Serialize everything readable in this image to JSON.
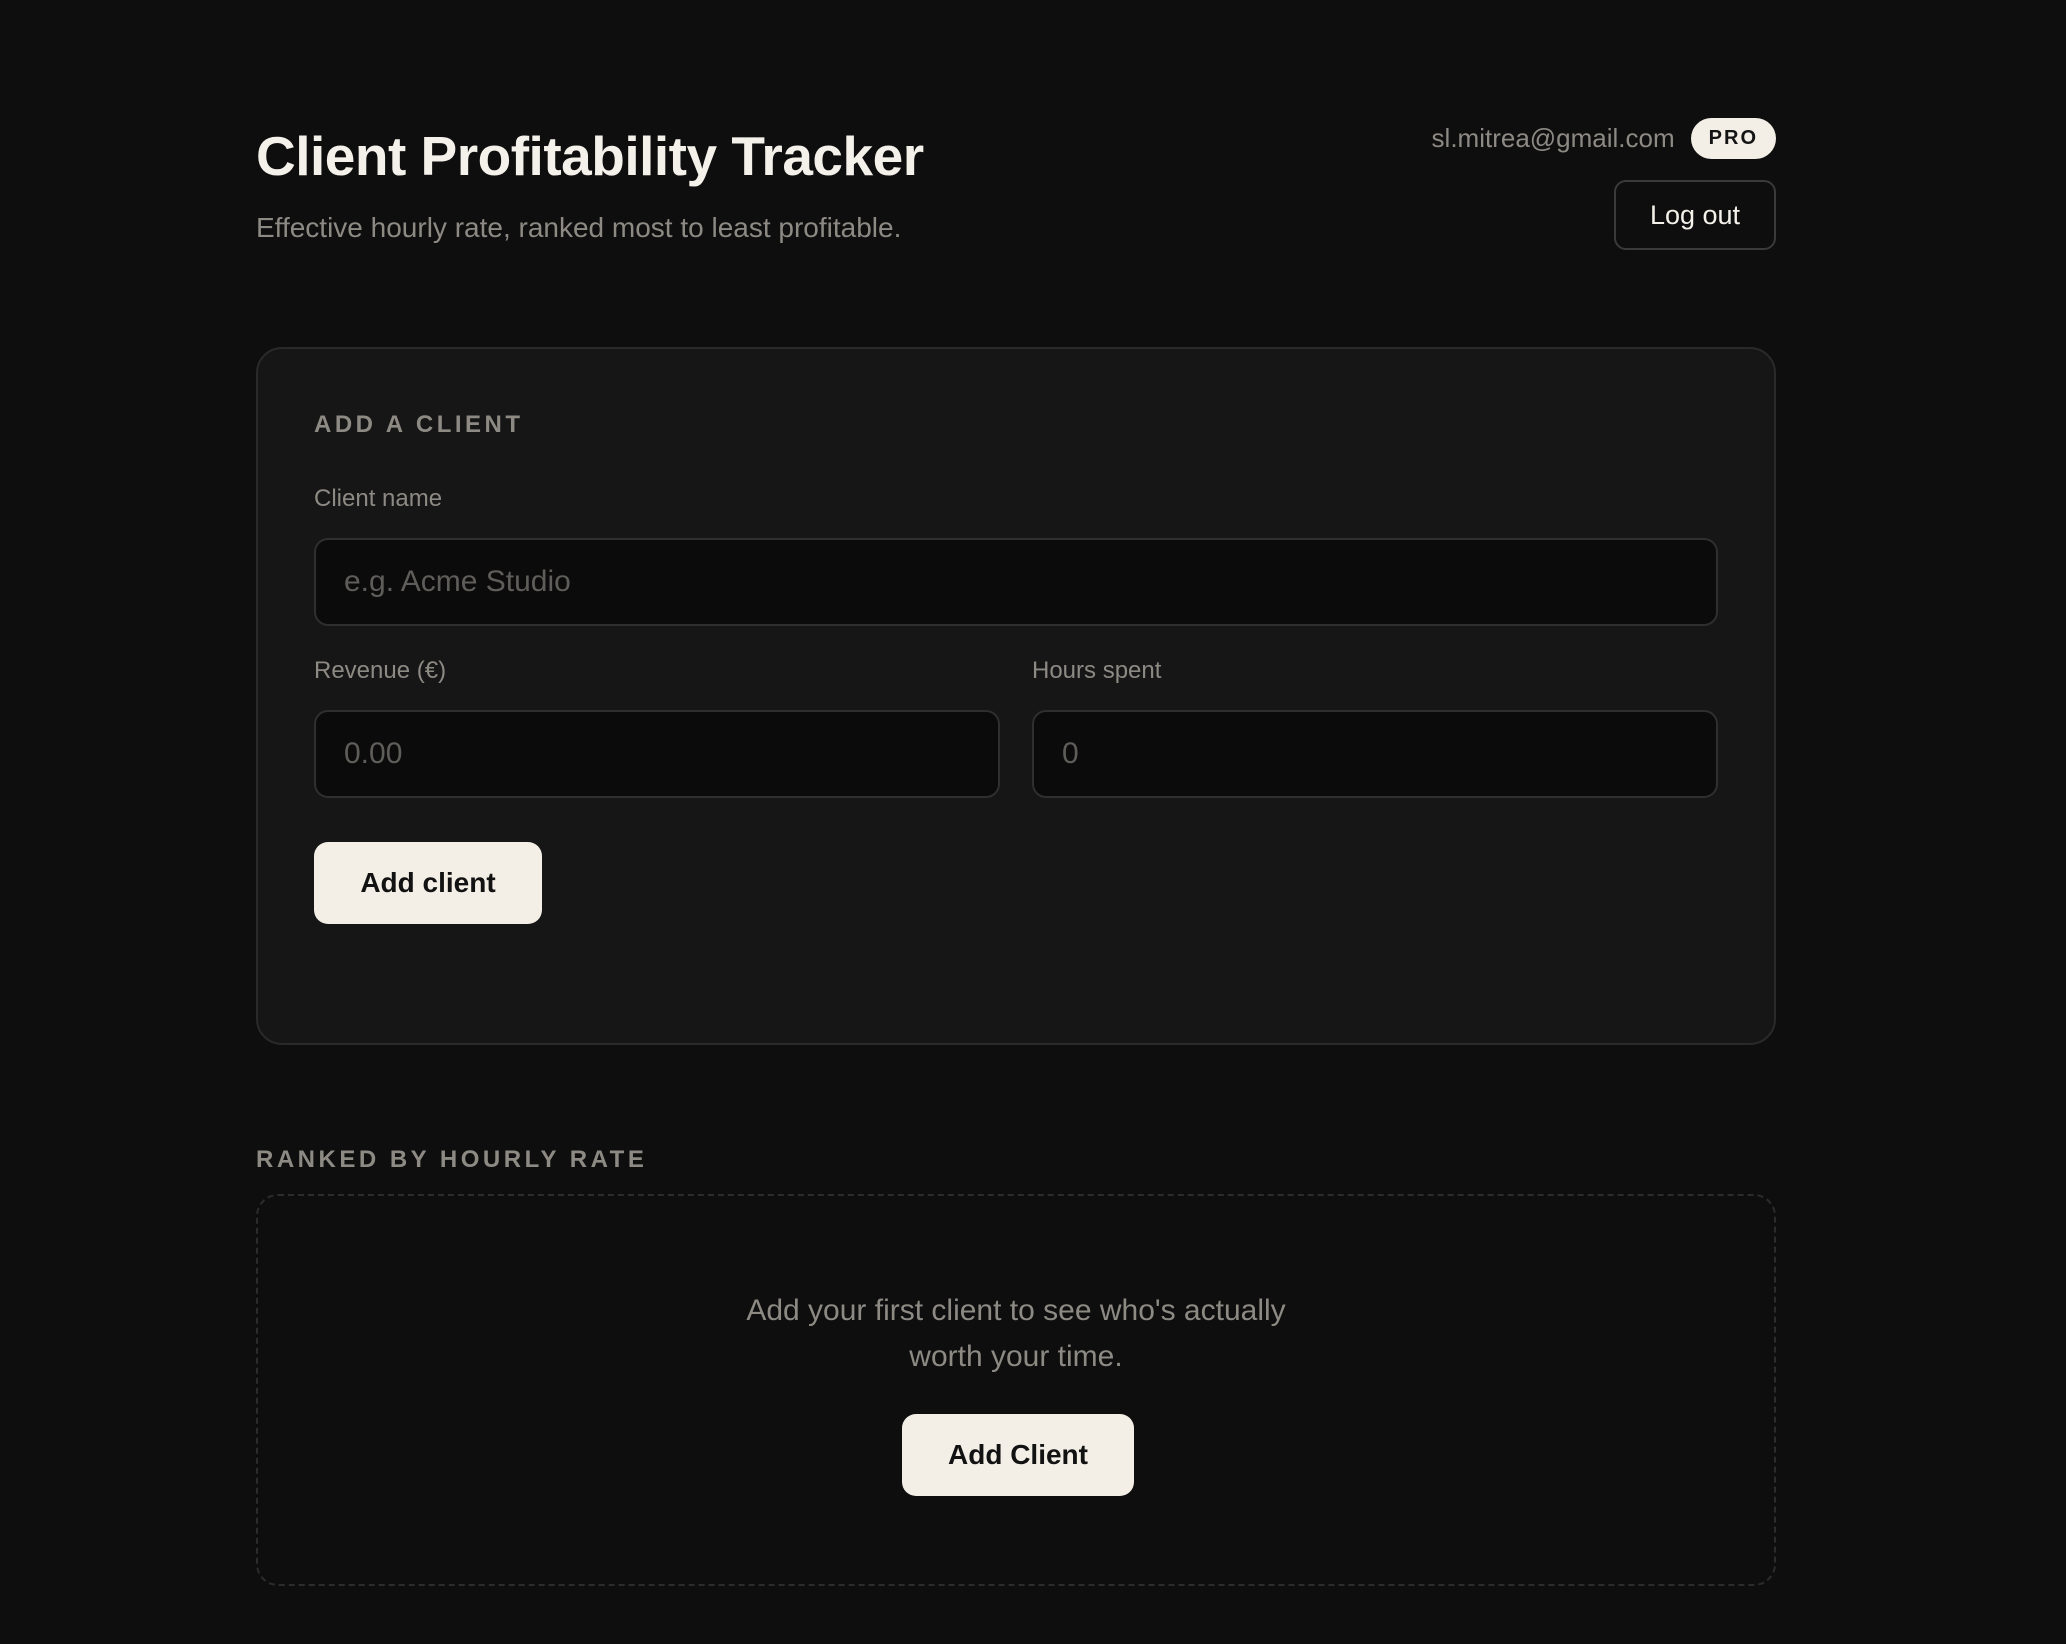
{
  "header": {
    "title": "Client Profitability Tracker",
    "subtitle": "Effective hourly rate, ranked most to least profitable.",
    "user_email": "sl.mitrea@gmail.com",
    "plan_badge": "PRO",
    "logout_label": "Log out"
  },
  "add_client_form": {
    "section_title": "ADD A CLIENT",
    "client_name": {
      "label": "Client name",
      "value": "",
      "placeholder": "e.g. Acme Studio"
    },
    "revenue": {
      "label": "Revenue (€)",
      "value": "",
      "placeholder": "0.00"
    },
    "hours": {
      "label": "Hours spent",
      "value": "",
      "placeholder": "0"
    },
    "submit_label": "Add client"
  },
  "ranking": {
    "section_title": "RANKED BY HOURLY RATE",
    "empty_state": {
      "line1": "Add your first client to see who's actually",
      "line2": "worth your time.",
      "cta_label": "Add Client"
    }
  },
  "colors": {
    "background": "#0e0e0e",
    "card": "#161616",
    "accent_button": "#f3efe7",
    "muted_text": "#8d8a84"
  }
}
